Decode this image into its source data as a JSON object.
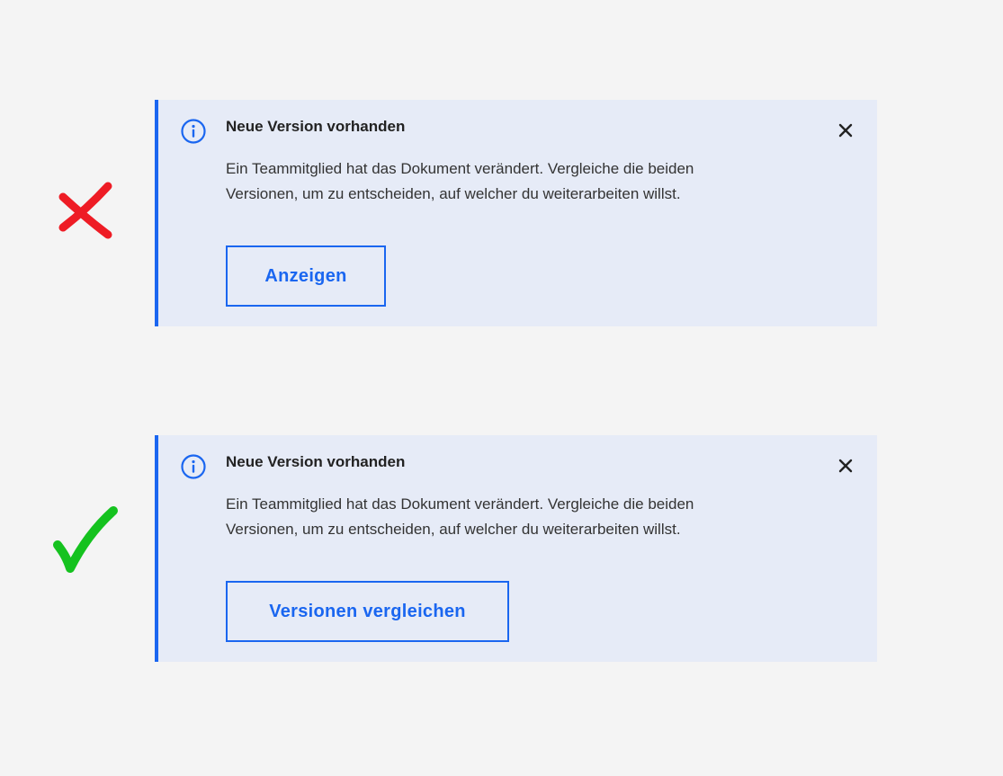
{
  "colors": {
    "background": "#f4f4f4",
    "notification_background": "#e6ebf7",
    "accent": "#1a66f0",
    "wrong_marker": "#ee1c25",
    "correct_marker": "#15c21f"
  },
  "examples": [
    {
      "marker_icon": "cross-icon",
      "notification": {
        "icon": "info-icon",
        "title": "Neue Version vorhanden",
        "message_lines": [
          "Ein Teammitglied  hat das Dokument verändert. Vergleiche die beiden",
          "Versionen, um zu entscheiden, auf welcher du weiterarbeiten willst."
        ],
        "close_icon": "close-icon",
        "action_label": "Anzeigen"
      }
    },
    {
      "marker_icon": "checkmark-icon",
      "notification": {
        "icon": "info-icon",
        "title": "Neue Version vorhanden",
        "message_lines": [
          "Ein Teammitglied  hat das Dokument verändert. Vergleiche die beiden",
          "Versionen, um zu entscheiden, auf welcher du weiterarbeiten willst."
        ],
        "close_icon": "close-icon",
        "action_label": "Versionen vergleichen"
      }
    }
  ]
}
